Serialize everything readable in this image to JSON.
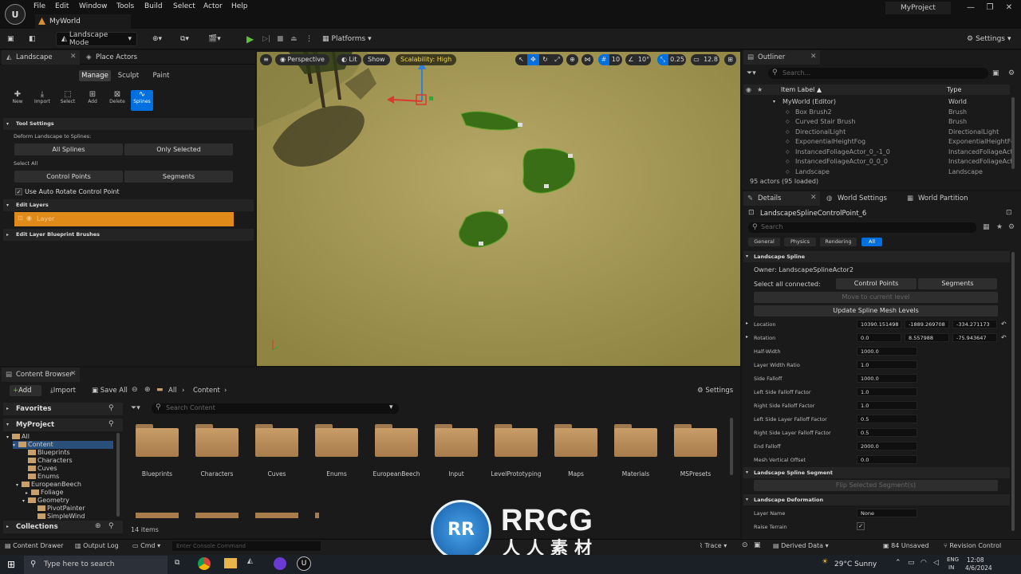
{
  "menu": [
    "File",
    "Edit",
    "Window",
    "Tools",
    "Build",
    "Select",
    "Actor",
    "Help"
  ],
  "world_tab": "MyWorld",
  "project_name": "MyProject",
  "toolbar": {
    "mode": "Landscape Mode",
    "platforms": "Platforms",
    "settings": "Settings"
  },
  "landscape_panel": {
    "tabs": [
      "Landscape",
      "Place Actors"
    ],
    "subtabs": [
      "Manage",
      "Sculpt",
      "Paint"
    ],
    "tools": [
      "New",
      "Import",
      "Select",
      "Add",
      "Delete",
      "Splines"
    ],
    "tool_settings": "Tool Settings",
    "deform_label": "Deform Landscape to Splines:",
    "all_splines": "All Splines",
    "only_selected": "Only Selected",
    "select_all": "Select All",
    "control_points": "Control Points",
    "segments": "Segments",
    "auto_rotate": "Use Auto Rotate Control Point",
    "edit_layers": "Edit Layers",
    "layer": "Layer",
    "edit_layer_bp": "Edit Layer Blueprint Brushes"
  },
  "viewport": {
    "perspective": "Perspective",
    "lit": "Lit",
    "show": "Show",
    "scalability": "Scalability: High",
    "grid_snap": "10",
    "rot_snap": "10°",
    "scale_snap": "0.25",
    "cam_speed": "12.8"
  },
  "outliner": {
    "tab": "Outliner",
    "search_placeholder": "Search...",
    "col_label": "Item Label ▲",
    "col_type": "Type",
    "rows": [
      {
        "label": "MyWorld (Editor)",
        "type": "World"
      },
      {
        "label": "Box Brush2",
        "type": "Brush"
      },
      {
        "label": "Curved Stair Brush",
        "type": "Brush"
      },
      {
        "label": "DirectionalLight",
        "type": "DirectionalLight"
      },
      {
        "label": "ExponentialHeightFog",
        "type": "ExponentialHeightFo"
      },
      {
        "label": "InstancedFoliageActor_0_-1_0",
        "type": "InstancedFoliageAct"
      },
      {
        "label": "InstancedFoliageActor_0_0_0",
        "type": "InstancedFoliageAct"
      },
      {
        "label": "Landscape",
        "type": "Landscape"
      }
    ],
    "status": "95 actors (95 loaded)"
  },
  "details": {
    "tabs": [
      "Details",
      "World Settings",
      "World Partition"
    ],
    "object": "LandscapeSplineControlPoint_6",
    "search_placeholder": "Search",
    "filters": [
      "General",
      "Physics",
      "Rendering",
      "All"
    ],
    "section_spline": "Landscape Spline",
    "owner": "Owner: LandscapeSplineActor2",
    "select_all_connected": "Select all connected:",
    "control_points": "Control Points",
    "segments": "Segments",
    "move_level": "Move to current level",
    "update_mesh": "Update Spline Mesh Levels",
    "location": {
      "label": "Location",
      "x": "10390.151498",
      "y": "-1889.269708",
      "z": "-334.271173"
    },
    "rotation": {
      "label": "Rotation",
      "x": "0.0",
      "y": "8.557988",
      "z": "-75.943647"
    },
    "props": [
      {
        "label": "Half-Width",
        "value": "1000.0"
      },
      {
        "label": "Layer Width Ratio",
        "value": "1.0"
      },
      {
        "label": "Side Falloff",
        "value": "1000.0"
      },
      {
        "label": "Left Side Falloff Factor",
        "value": "1.0"
      },
      {
        "label": "Right Side Falloff Factor",
        "value": "1.0"
      },
      {
        "label": "Left Side Layer Falloff Factor",
        "value": "0.5"
      },
      {
        "label": "Right Side Layer Falloff Factor",
        "value": "0.5"
      },
      {
        "label": "End Falloff",
        "value": "2000.0"
      },
      {
        "label": "Mesh Vertical Offset",
        "value": "0.0"
      }
    ],
    "section_segment": "Landscape Spline Segment",
    "flip_segment": "Flip Selected Segment(s)",
    "section_deformation": "Landscape Deformation",
    "layer_name": {
      "label": "Layer Name",
      "value": "None"
    },
    "raise_terrain": "Raise Terrain"
  },
  "content_browser": {
    "tab": "Content Browser",
    "add": "Add",
    "import": "Import",
    "save_all": "Save All",
    "path": [
      "All",
      "Content"
    ],
    "settings": "Settings",
    "favorites": "Favorites",
    "project": "MyProject",
    "search_placeholder": "Search Content",
    "tree": [
      "All",
      "Content",
      "Blueprints",
      "Characters",
      "Cuves",
      "Enums",
      "EuropeanBeech",
      "Foliage",
      "Geometry",
      "PivotPainter",
      "SimpleWind"
    ],
    "folders": [
      "Blueprints",
      "Characters",
      "Cuves",
      "Enums",
      "EuropeanBeech",
      "Input",
      "LevelPrototyping",
      "Maps",
      "Materials",
      "MSPresets"
    ],
    "collections": "Collections",
    "item_count": "14 items"
  },
  "statusbar": {
    "content_drawer": "Content Drawer",
    "output_log": "Output Log",
    "cmd": "Cmd",
    "console_placeholder": "Enter Console Command",
    "trace": "Trace",
    "derived_data": "Derived Data",
    "unsaved": "84 Unsaved",
    "revision": "Revision Control"
  },
  "taskbar": {
    "search_placeholder": "Type here to search",
    "weather": "29°C  Sunny",
    "lang": "ENG",
    "region": "IN",
    "time": "12:08",
    "date": "4/6/2024"
  },
  "watermark": {
    "brand": "RRCG",
    "subtitle": "人人素材"
  }
}
